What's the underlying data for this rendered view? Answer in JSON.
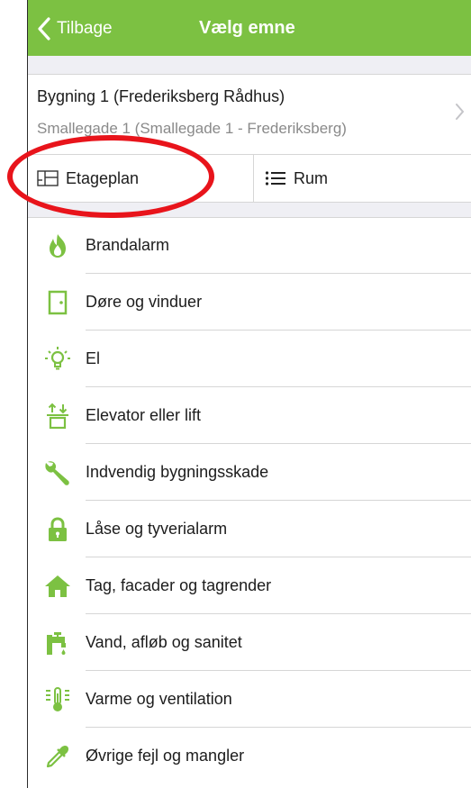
{
  "navbar": {
    "back_label": "Tilbage",
    "title": "Vælg emne"
  },
  "building": {
    "name": "Bygning 1 (Frederiksberg Rådhus)",
    "address": "Smallegade 1 (Smallegade 1 - Frederiksberg)"
  },
  "tabs": [
    {
      "label": "Etageplan",
      "icon": "floorplan-icon"
    },
    {
      "label": "Rum",
      "icon": "list-icon"
    }
  ],
  "categories": [
    {
      "label": "Brandalarm",
      "icon": "flame-icon"
    },
    {
      "label": "Døre og vinduer",
      "icon": "door-icon"
    },
    {
      "label": "El",
      "icon": "lightbulb-icon"
    },
    {
      "label": "Elevator eller lift",
      "icon": "elevator-icon"
    },
    {
      "label": "Indvendig bygningsskade",
      "icon": "wrench-icon"
    },
    {
      "label": "Låse og tyverialarm",
      "icon": "padlock-icon"
    },
    {
      "label": "Tag, facader og tagrender",
      "icon": "house-icon"
    },
    {
      "label": "Vand, afløb og sanitet",
      "icon": "faucet-icon"
    },
    {
      "label": "Varme og ventilation",
      "icon": "thermometer-icon"
    },
    {
      "label": "Øvrige fejl og mangler",
      "icon": "pipette-icon"
    }
  ],
  "colors": {
    "accent": "#7cc142",
    "annotation": "#e8141b"
  }
}
